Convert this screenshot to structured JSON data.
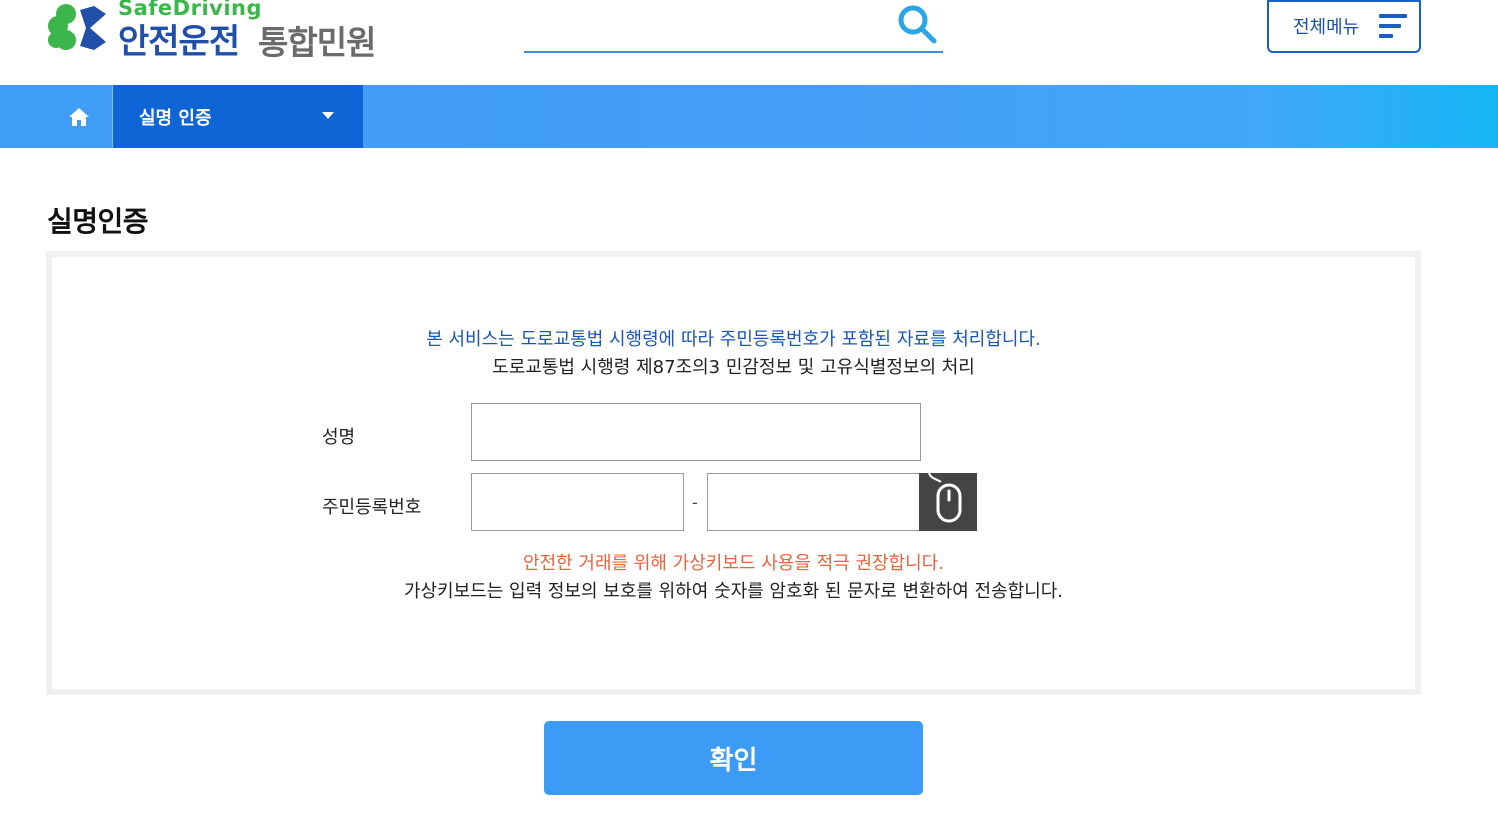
{
  "header": {
    "logo_sub": "SafeDriving",
    "logo_main": "안전운전",
    "logo_main2": "통합민원",
    "search": {
      "value": "",
      "placeholder": ""
    },
    "all_menu_label": "전체메뉴"
  },
  "navbar": {
    "selected_menu": "실명 인증"
  },
  "main": {
    "page_title": "실명인증",
    "notice_line1": "본 서비스는 도로교통법 시행령에 따라 주민등록번호가 포함된 자료를 처리합니다.",
    "notice_line2": "도로교통법 시행령 제87조의3 민감정보 및 고유식별정보의 처리",
    "form": {
      "name_label": "성명",
      "name_value": "",
      "rrn_label": "주민등록번호",
      "rrn_front_value": "",
      "rrn_separator": "-",
      "rrn_back_value": ""
    },
    "warning_line1": "안전한 거래를 위해 가상키보드 사용을 적극 권장합니다.",
    "warning_line2": "가상키보드는 입력 정보의 보호를 위하여 숫자를 암호화 된 문자로 변환하여 전송합니다.",
    "confirm_label": "확인"
  },
  "colors": {
    "brand_blue": "#1f4fa8",
    "brand_green": "#3cb54a",
    "nav_blue": "#3f9df5",
    "nav_selected": "#0f64d6",
    "notice_blue": "#1a56b8",
    "warning_orange": "#e8633f",
    "button_blue": "#3c9cf5"
  },
  "icons": {
    "logo": "clover-logo-icon",
    "search": "search-icon",
    "menu": "hamburger-menu-icon",
    "home": "home-icon",
    "dropdown": "caret-down-icon",
    "virtual_keyboard": "mouse-icon"
  }
}
